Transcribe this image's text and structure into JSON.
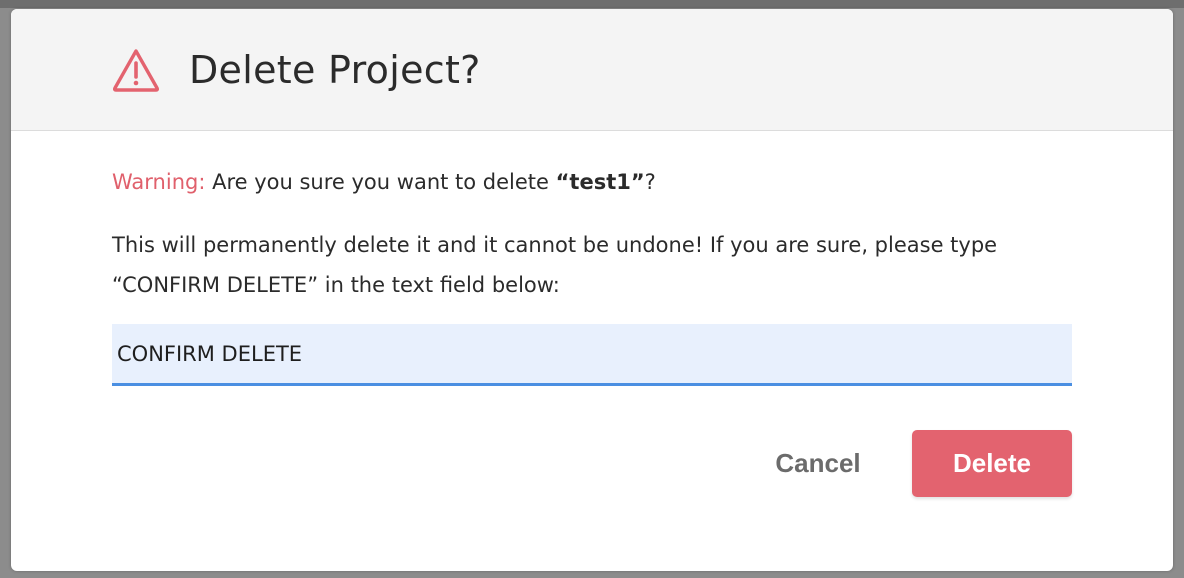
{
  "dialog": {
    "title": "Delete Project?",
    "icon": "warning-triangle-icon",
    "warning_label": "Warning:",
    "warning_text_before": " Are you sure you want to delete ",
    "project_name": "“test1”",
    "warning_text_after": "?",
    "instructions": "This will permanently delete it and it cannot be undone! If you are sure, please type “CONFIRM DELETE” in the text field below:",
    "confirm_input_value": "CONFIRM DELETE",
    "cancel_label": "Cancel",
    "delete_label": "Delete"
  },
  "colors": {
    "accent_danger": "#e3636f",
    "warning_text": "#e0606c",
    "input_background": "#e8f0fd",
    "input_focus_border": "#4a8fe2",
    "header_background": "#f4f4f4"
  }
}
